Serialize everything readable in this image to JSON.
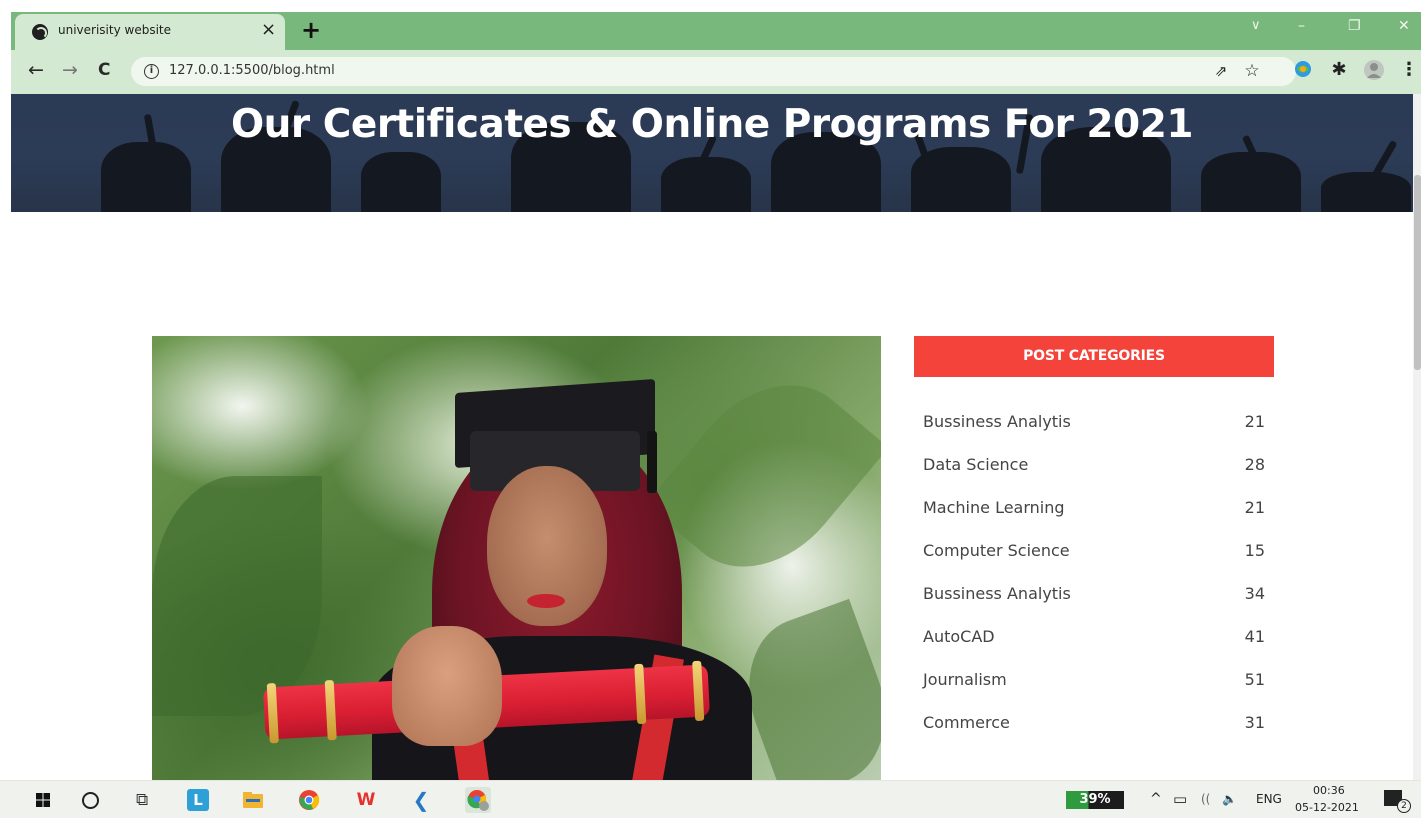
{
  "browser": {
    "tab_title": "univerisity website",
    "tab_close_glyph": "×",
    "new_tab_glyph": "+",
    "url": "127.0.0.1:5500/blog.html",
    "info_glyph": "i",
    "nav": {
      "back": "←",
      "forward": "→",
      "reload": "C"
    },
    "window_controls": {
      "dropdown": "∨",
      "minimize": "–",
      "restore": "❐",
      "close": "✕"
    },
    "toolbar_icons": [
      "share-icon",
      "star-icon",
      "extension-icon",
      "puzzle-icon",
      "profile-avatar-icon",
      "more-icon"
    ],
    "toolbar_glyphs": {
      "share": "⇗",
      "star": "☆",
      "puzzle": "✱",
      "more": "⋮"
    },
    "accent_color": "#79b87c",
    "toolbar_color": "#d4e9d2"
  },
  "hero": {
    "title": "Our Certificates & Online Programs For 2021"
  },
  "sidebar": {
    "header": "POST CATEGORIES",
    "header_color": "#f4433a",
    "categories": [
      {
        "name": "Bussiness Analytis",
        "count": "21"
      },
      {
        "name": "Data Science",
        "count": "28"
      },
      {
        "name": "Machine Learning",
        "count": "21"
      },
      {
        "name": "Computer Science",
        "count": "15"
      },
      {
        "name": "Bussiness Analytis",
        "count": "34"
      },
      {
        "name": "AutoCAD",
        "count": "41"
      },
      {
        "name": "Journalism",
        "count": "51"
      },
      {
        "name": "Commerce",
        "count": "31"
      }
    ]
  },
  "taskbar": {
    "apps": [
      "windows-start-icon",
      "cortana-search-icon",
      "task-view-icon",
      "app-l-icon",
      "file-explorer-icon",
      "chrome-icon",
      "wps-office-icon",
      "vscode-icon",
      "chrome-profile-icon"
    ],
    "app_labels": {
      "l_app": "L",
      "wps": "W",
      "taskview": "⧉",
      "vscode": "❮"
    },
    "battery": "39%",
    "battery_level": 0.39,
    "tray_chevron": "^",
    "tray_icons": [
      "battery-tray-icon",
      "wifi-icon",
      "volume-icon"
    ],
    "tray_glyphs": {
      "battery": "▭",
      "wifi": "((",
      "volume": "🔈"
    },
    "language": "ENG",
    "time": "00:36",
    "date": "05-12-2021",
    "notification_count": "2"
  }
}
